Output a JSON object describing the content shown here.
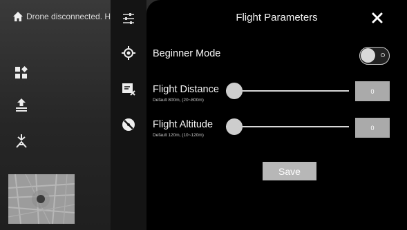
{
  "status_bar": {
    "connection_text": "Drone disconnected. H"
  },
  "panel": {
    "title": "Flight Parameters",
    "beginner_mode": {
      "label": "Beginner Mode",
      "enabled": false
    },
    "flight_distance": {
      "label": "Flight Distance",
      "hint": "Default 800m, (20~800m)",
      "value": "0"
    },
    "flight_altitude": {
      "label": "Flight Altitude",
      "hint": "Default 120m, (10~120m)",
      "value": "0"
    },
    "save_label": "Save"
  },
  "icons": {
    "status": "home-icon",
    "left_tools": [
      "grid-icon",
      "upload-icon",
      "return-home-icon"
    ],
    "settings_menu": [
      "sliders-icon",
      "target-icon",
      "media-delete-icon",
      "propeller-icon"
    ],
    "close": "close-icon"
  },
  "colors": {
    "panel_bg": "#000000",
    "control_gray": "#aaaaaa"
  }
}
